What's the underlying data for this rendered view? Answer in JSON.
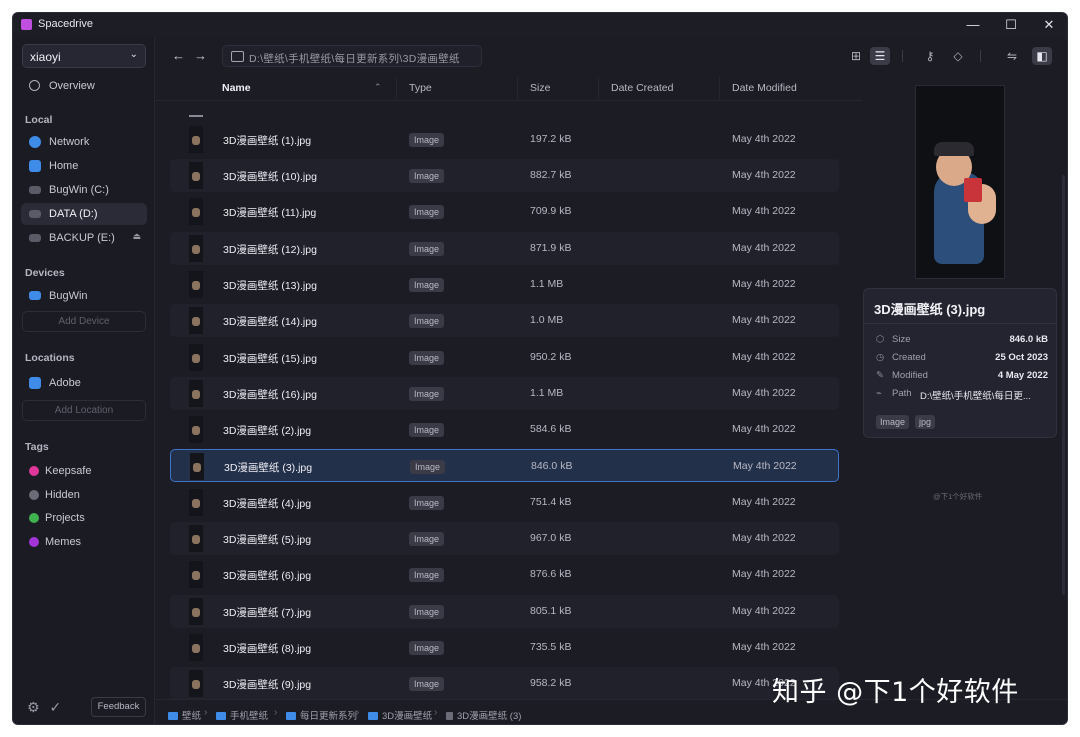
{
  "window": {
    "title": "Spacedrive",
    "controls": [
      "—",
      "☐",
      "✕"
    ]
  },
  "sidebar": {
    "user": "xiaoyi",
    "overview": "Overview",
    "local_title": "Local",
    "local_items": [
      {
        "label": "Network",
        "icon": "network-icon",
        "color": "#3f8ce8"
      },
      {
        "label": "Home",
        "icon": "home-folder-icon",
        "color": "#3f8ce8"
      },
      {
        "label": "BugWin (C:)",
        "icon": "drive-icon",
        "color": "#6b6c78"
      },
      {
        "label": "DATA (D:)",
        "icon": "drive-icon",
        "color": "#6b6c78"
      },
      {
        "label": "BACKUP (E:)",
        "icon": "drive-icon",
        "color": "#6b6c78"
      }
    ],
    "devices_title": "Devices",
    "device": "BugWin",
    "add_device": "Add Device",
    "locations_title": "Locations",
    "location": "Adobe",
    "add_location": "Add Location",
    "tags_title": "Tags",
    "tags": [
      {
        "label": "Keepsafe",
        "color": "#e0379a"
      },
      {
        "label": "Hidden",
        "color": "#6b6c78"
      },
      {
        "label": "Projects",
        "color": "#3fb24f"
      },
      {
        "label": "Memes",
        "color": "#a335d8"
      }
    ],
    "feedback": "Feedback"
  },
  "toolbar": {
    "path": "D:\\壁纸\\手机壁纸\\每日更新系列\\3D漫画壁纸"
  },
  "columns": {
    "name": "Name",
    "type": "Type",
    "size": "Size",
    "created": "Date Created",
    "modified": "Date Modified"
  },
  "files": [
    {
      "name": "3D漫画壁纸 (1).jpg",
      "type": "Image",
      "size": "197.2 kB",
      "modified": "May 4th 2022"
    },
    {
      "name": "3D漫画壁纸 (10).jpg",
      "type": "Image",
      "size": "882.7 kB",
      "modified": "May 4th 2022"
    },
    {
      "name": "3D漫画壁纸 (11).jpg",
      "type": "Image",
      "size": "709.9 kB",
      "modified": "May 4th 2022"
    },
    {
      "name": "3D漫画壁纸 (12).jpg",
      "type": "Image",
      "size": "871.9 kB",
      "modified": "May 4th 2022"
    },
    {
      "name": "3D漫画壁纸 (13).jpg",
      "type": "Image",
      "size": "1.1 MB",
      "modified": "May 4th 2022"
    },
    {
      "name": "3D漫画壁纸 (14).jpg",
      "type": "Image",
      "size": "1.0 MB",
      "modified": "May 4th 2022"
    },
    {
      "name": "3D漫画壁纸 (15).jpg",
      "type": "Image",
      "size": "950.2 kB",
      "modified": "May 4th 2022"
    },
    {
      "name": "3D漫画壁纸 (16).jpg",
      "type": "Image",
      "size": "1.1 MB",
      "modified": "May 4th 2022"
    },
    {
      "name": "3D漫画壁纸 (2).jpg",
      "type": "Image",
      "size": "584.6 kB",
      "modified": "May 4th 2022"
    },
    {
      "name": "3D漫画壁纸 (3).jpg",
      "type": "Image",
      "size": "846.0 kB",
      "modified": "May 4th 2022"
    },
    {
      "name": "3D漫画壁纸 (4).jpg",
      "type": "Image",
      "size": "751.4 kB",
      "modified": "May 4th 2022"
    },
    {
      "name": "3D漫画壁纸 (5).jpg",
      "type": "Image",
      "size": "967.0 kB",
      "modified": "May 4th 2022"
    },
    {
      "name": "3D漫画壁纸 (6).jpg",
      "type": "Image",
      "size": "876.6 kB",
      "modified": "May 4th 2022"
    },
    {
      "name": "3D漫画壁纸 (7).jpg",
      "type": "Image",
      "size": "805.1 kB",
      "modified": "May 4th 2022"
    },
    {
      "name": "3D漫画壁纸 (8).jpg",
      "type": "Image",
      "size": "735.5 kB",
      "modified": "May 4th 2022"
    },
    {
      "name": "3D漫画壁纸 (9).jpg",
      "type": "Image",
      "size": "958.2 kB",
      "modified": "May 4th 2022"
    }
  ],
  "inspector": {
    "title": "3D漫画壁纸 (3).jpg",
    "size_label": "Size",
    "size": "846.0 kB",
    "created_label": "Created",
    "created": "25 Oct 2023",
    "modified_label": "Modified",
    "modified": "4 May 2022",
    "path_label": "Path",
    "path": "D:\\壁纸\\手机壁纸\\每日更...",
    "chips": [
      "Image",
      "jpg"
    ],
    "small_watermark": "@下1个好软件"
  },
  "statusbar": {
    "crumbs": [
      "壁纸",
      "手机壁纸",
      "每日更新系列",
      "3D漫画壁纸",
      "3D漫画壁纸 (3)"
    ]
  },
  "watermark": "知乎 @下1个好软件",
  "colors": {
    "accent": "#3b74c9",
    "background": "#1b1c24"
  }
}
